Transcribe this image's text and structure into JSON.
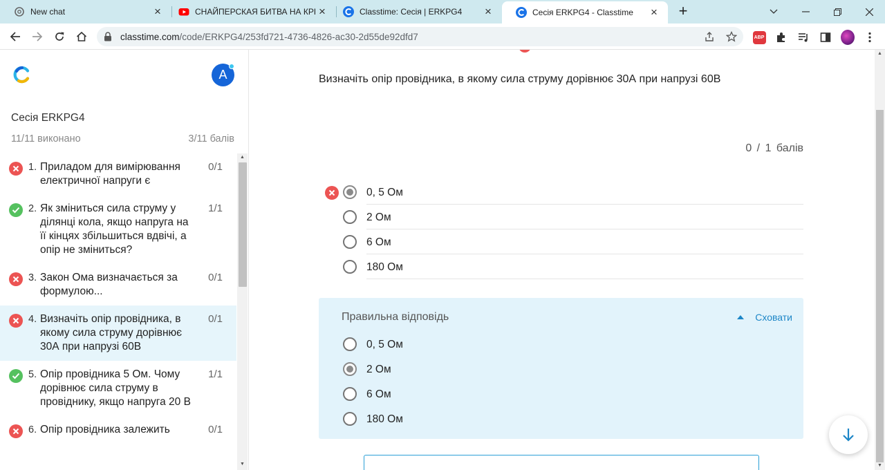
{
  "browser": {
    "tabs": [
      {
        "title": "New chat",
        "favicon": "openai-icon",
        "active": false
      },
      {
        "title": "СНАЙПЕРСКАЯ БИТВА НА КРЫШЕ",
        "favicon": "youtube-icon",
        "active": false
      },
      {
        "title": "Classtime: Сесія | ERKPG4",
        "favicon": "classtime-icon",
        "active": false
      },
      {
        "title": "Сесія ERKPG4 - Classtime",
        "favicon": "classtime-icon",
        "active": true
      }
    ],
    "url_domain": "classtime.com",
    "url_path": "/code/ERKPG4/253fd721-4736-4826-ac30-2d55de92dfd7",
    "abp_label": "ABP"
  },
  "sidebar": {
    "avatar_letter": "A",
    "session_title": "Сесія ERKPG4",
    "progress": "11/11 виконано",
    "score": "3/11 балів",
    "questions": [
      {
        "num": "1.",
        "text": "Приладом для вимірювання електричної напруги є",
        "points": "0/1",
        "status": "wrong"
      },
      {
        "num": "2.",
        "text": "Як зміниться сила струму у ділянці кола, якщо напруга на її кінцях збільшиться вдвічі, а опір не зміниться?",
        "points": "1/1",
        "status": "right"
      },
      {
        "num": "3.",
        "text": "Закон Ома визначається за формулою...",
        "points": "0/1",
        "status": "wrong"
      },
      {
        "num": "4.",
        "text": "Визначіть опір провідника, в якому сила струму дорівнює 30А при напрузі 60В",
        "points": "0/1",
        "status": "wrong"
      },
      {
        "num": "5.",
        "text": "Опір провідника 5 Ом. Чому дорівнює сила струму в провіднику, якщо напруга 20 В",
        "points": "1/1",
        "status": "right"
      },
      {
        "num": "6.",
        "text": "Опір провідника залежить",
        "points": "0/1",
        "status": "wrong"
      }
    ]
  },
  "main": {
    "question": "Визначіть опір провідника, в якому сила струму дорівнює 30А при напрузі 60В",
    "points": "0 / 1 балів",
    "answers": [
      "0, 5 Ом",
      "2 Ом",
      "6 Ом",
      "180 Ом"
    ],
    "selected_index": 0,
    "correct_panel": {
      "title": "Правильна відповідь",
      "hide_label": "Сховати",
      "answers": [
        "0, 5 Ом",
        "2 Ом",
        "6 Ом",
        "180 Ом"
      ],
      "correct_index": 1
    }
  },
  "colors": {
    "wrong": "#ec5453",
    "right": "#55c15f",
    "accent": "#1d86c7",
    "panel_bg": "#e2f3fb",
    "active_item_bg": "#e6f5fb"
  }
}
